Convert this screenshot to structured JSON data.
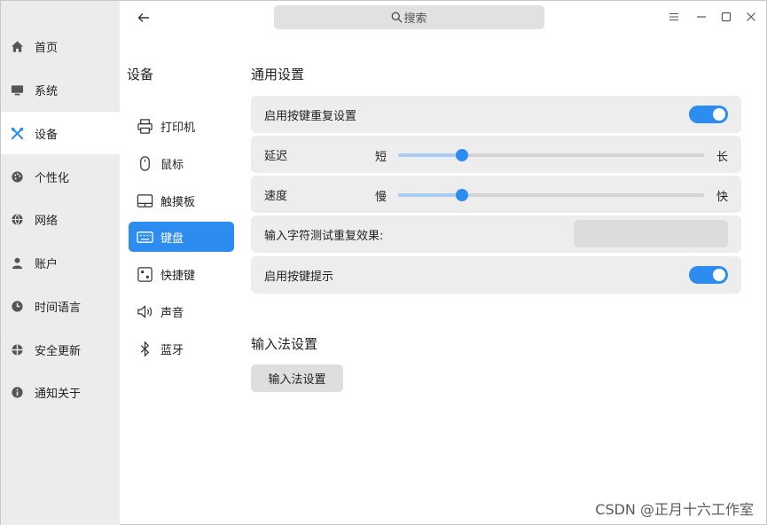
{
  "sidebar": {
    "items": [
      {
        "label": "首页",
        "icon": "home-icon"
      },
      {
        "label": "系统",
        "icon": "monitor-icon"
      },
      {
        "label": "设备",
        "icon": "tools-icon",
        "active": true
      },
      {
        "label": "个性化",
        "icon": "palette-icon"
      },
      {
        "label": "网络",
        "icon": "globe-icon"
      },
      {
        "label": "账户",
        "icon": "user-icon"
      },
      {
        "label": "时间语言",
        "icon": "clock-icon"
      },
      {
        "label": "安全更新",
        "icon": "shield-icon"
      },
      {
        "label": "通知关于",
        "icon": "info-icon"
      }
    ]
  },
  "titlebar": {
    "search_label": "搜索"
  },
  "devices": {
    "title": "设备",
    "items": [
      {
        "label": "打印机",
        "icon": "printer-icon"
      },
      {
        "label": "鼠标",
        "icon": "mouse-icon"
      },
      {
        "label": "触摸板",
        "icon": "touchpad-icon"
      },
      {
        "label": "键盘",
        "icon": "keyboard-icon",
        "active": true
      },
      {
        "label": "快捷键",
        "icon": "shortcut-icon"
      },
      {
        "label": "声音",
        "icon": "speaker-icon"
      },
      {
        "label": "蓝牙",
        "icon": "bluetooth-icon"
      }
    ]
  },
  "general": {
    "title": "通用设置",
    "repeat_label": "启用按键重复设置",
    "repeat_enabled": true,
    "delay": {
      "label": "延迟",
      "min_label": "短",
      "max_label": "长",
      "value": 0.21
    },
    "speed": {
      "label": "速度",
      "min_label": "慢",
      "max_label": "快",
      "value": 0.21
    },
    "test_label": "输入字符测试重复效果:",
    "test_value": "",
    "hint_label": "启用按键提示",
    "hint_enabled": true
  },
  "ime": {
    "title": "输入法设置",
    "button_label": "输入法设置"
  },
  "watermark": "CSDN @正月十六工作室",
  "colors": {
    "accent": "#2d8cf0",
    "sidebar_bg": "#ececec",
    "row_bg": "#ededed"
  }
}
